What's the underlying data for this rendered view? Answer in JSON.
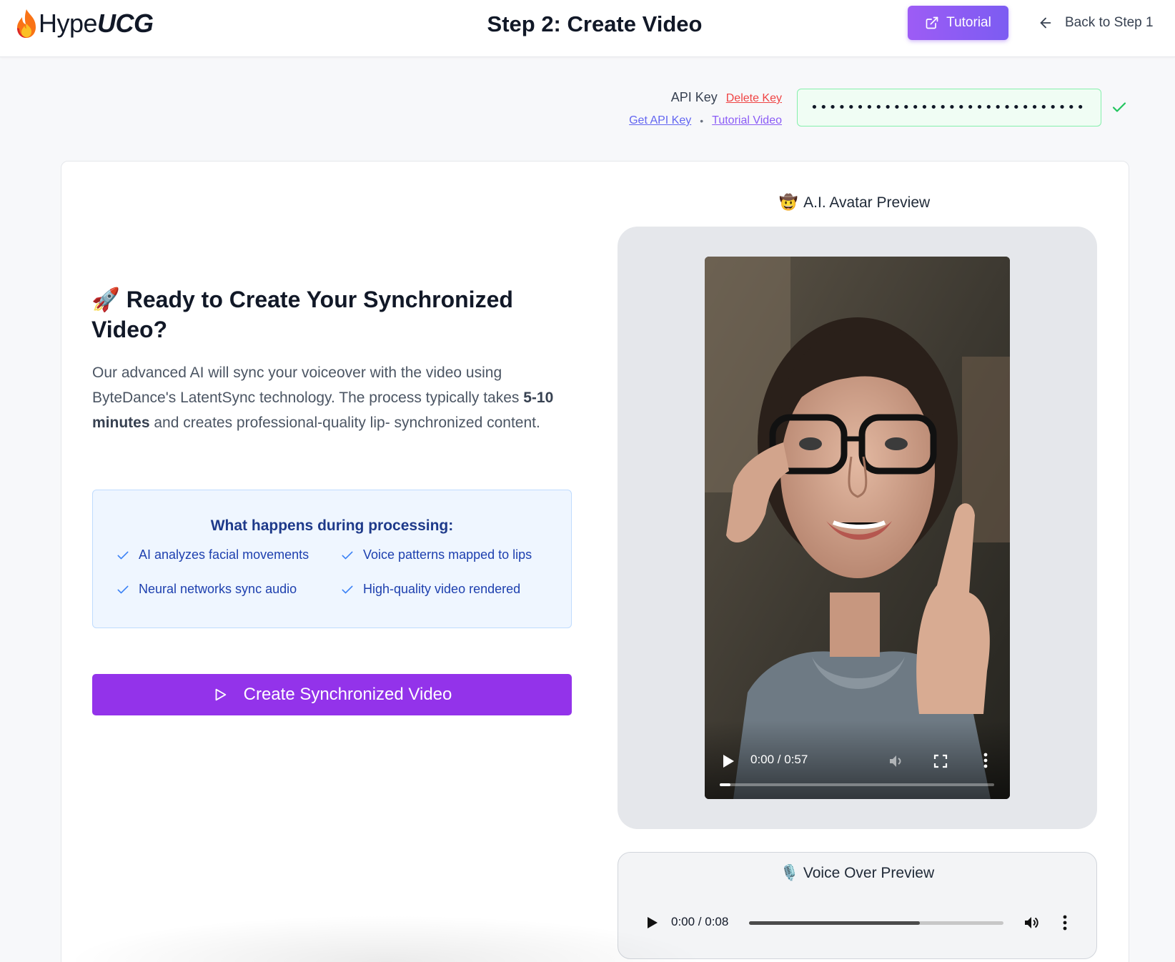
{
  "header": {
    "logo_hype": "Hype",
    "logo_ucg": "UCG",
    "title": "Step 2: Create Video",
    "tutorial_label": "Tutorial",
    "back_label": "Back to Step 1"
  },
  "api": {
    "label": "API Key",
    "delete_label": "Delete Key",
    "get_key_label": "Get API Key",
    "separator": "•",
    "tutorial_video_label": "Tutorial Video",
    "masked_value": "••••••••••••••••••••••••••••••••••••••••",
    "status": "valid",
    "status_color": "#22c55e"
  },
  "ready": {
    "emoji": "🚀",
    "title": "Ready to Create Your Synchronized Video?",
    "desc_part1": "Our advanced AI will sync your voiceover with the video using ByteDance's LatentSync technology. The process typically takes ",
    "desc_bold": "5-10 minutes",
    "desc_part2": " and creates professional-quality lip- synchronized content."
  },
  "processing": {
    "title": "What happens during processing:",
    "items": [
      "AI analyzes facial movements",
      "Voice patterns mapped to lips",
      "Neural networks sync audio",
      "High-quality video rendered"
    ]
  },
  "create_button": {
    "label": "Create Synchronized Video",
    "color": "#9333ea"
  },
  "avatar": {
    "emoji": "🤠",
    "title": "A.I. Avatar Preview",
    "video_time": "0:00 / 0:57",
    "progress": 0.04
  },
  "voice": {
    "emoji": "🎙️",
    "title": "Voice Over Preview",
    "audio_time": "0:00 / 0:08",
    "progress": 0.67
  }
}
